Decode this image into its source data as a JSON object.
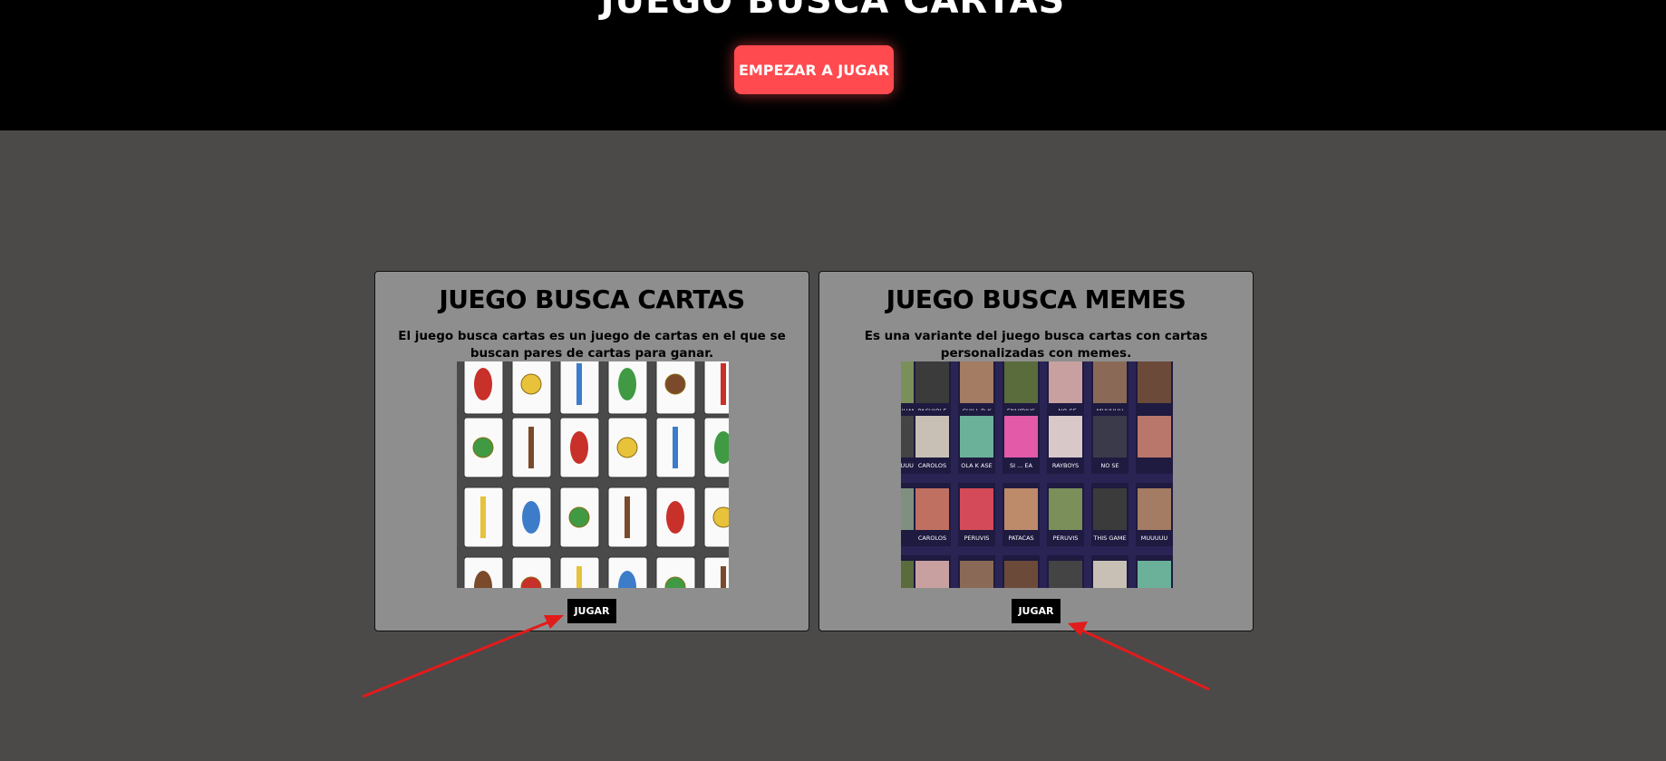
{
  "header": {
    "title": "JUEGO BUSCA CARTAS",
    "start_button_label": "EMPEZAR A JUGAR"
  },
  "cards": [
    {
      "title": "JUEGO BUSCA CARTAS",
      "description": "El juego busca cartas es un juego de cartas en el que se buscan pares de cartas para ganar.",
      "button_label": "JUGAR"
    },
    {
      "title": "JUEGO BUSCA MEMES",
      "description": "Es una variante del juego busca cartas con cartas personalizadas con memes.",
      "button_label": "JUGAR",
      "meme_labels": [
        [
          "JUUAMPY",
          "PACHIOLE",
          "CHILL D K",
          "ENVIDIUS",
          ", NO SE",
          "MUUUUU"
        ],
        [
          "JUUUUU",
          "CAROLOS",
          "OLA K ASE",
          "SI ... EA",
          "RAYBOYS",
          "NO SE"
        ],
        [
          "",
          "CAROLOS",
          "PERUVIS",
          "PATACAS",
          "PERUVIS",
          "THIS GAME",
          "MUUUUU"
        ],
        [
          "",
          "",
          "",
          "",
          "",
          "",
          ""
        ]
      ]
    }
  ],
  "colors": {
    "top_bar": "#000000",
    "page_bg": "#4b4a49",
    "card_bg": "#8e8e8e",
    "start_button": "#ff4a4f",
    "arrow": "#e21b1b"
  }
}
